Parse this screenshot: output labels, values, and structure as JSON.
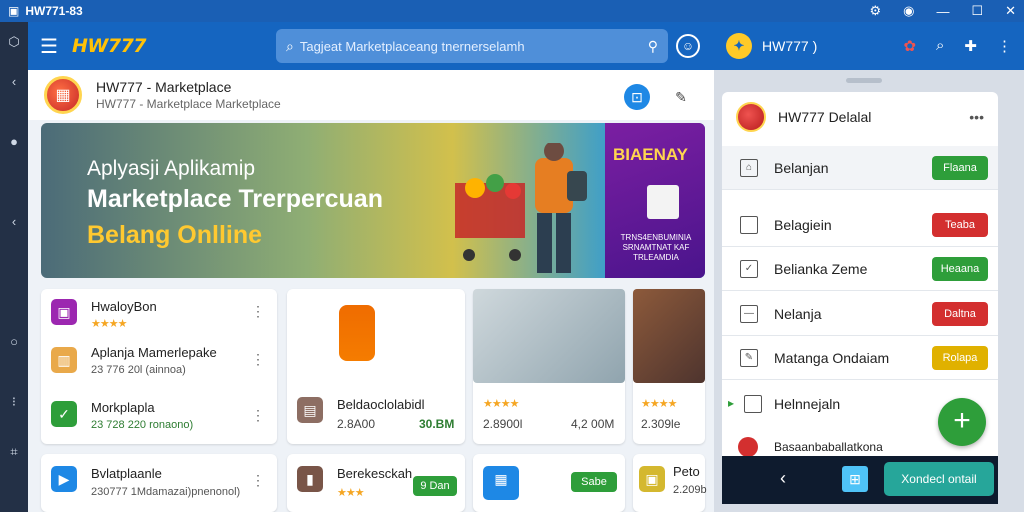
{
  "window": {
    "title": "HW771-83",
    "controls": [
      "gear-icon",
      "wifi-icon",
      "minimize-icon",
      "maximize-icon",
      "close-icon"
    ]
  },
  "app": {
    "brand": "HW777"
  },
  "search": {
    "placeholder": "Tagjeat Marketplaceang tnernerselamh"
  },
  "product_header": {
    "title": "HW777 - Marketplace",
    "subtitle": "HW777 - Marketplace Marketplace"
  },
  "banner": {
    "line1": "Aplyasji Aplikamip",
    "line2": "Marketplace Trerpercuan",
    "line3": "Belang Onlline",
    "promo_title": "BIAENAY",
    "promo_fine": "TRNS4ENBUMINIA SRNAMTNAT KAF TRLEAMDIA"
  },
  "list_card_1": {
    "items": [
      {
        "title": "HwaloyBon",
        "rating": "★★★★",
        "icon": "bag-icon"
      },
      {
        "title": "Aplanja Mamerlepake",
        "sub": "23 776 20l (ainnoa)",
        "icon": "box-icon"
      },
      {
        "title": "Morkplapla",
        "sub": "23 728 220 ronaono)",
        "icon": "check-icon"
      }
    ]
  },
  "product_cards": [
    {
      "title": "Beldaoclolabidl",
      "price": "2.8A00",
      "price2": "30.BM"
    },
    {
      "rating": "★★★★",
      "price": "2.8900l",
      "price2": "4,2 00M"
    },
    {
      "rating": "★★★★",
      "price": "2.309le"
    }
  ],
  "list_card_2": {
    "title": "Bvlatplaanle",
    "sub": "230777 1Mdamazai)pnenonol)"
  },
  "bottom_cards": [
    {
      "title": "Berekesckah",
      "rating": "★★★",
      "button": "9 Dan"
    },
    {
      "button": "Sabe"
    },
    {
      "title": "Peto",
      "price": "2.209b"
    }
  ],
  "right_header": {
    "name": "HW777 )"
  },
  "detail_panel": {
    "title": "HW777 Delalal",
    "rows": [
      {
        "label": "Belanjan",
        "button": "Flaana",
        "color": "#2e9e3a"
      },
      {
        "label": "Belagiein",
        "button": "Teaba",
        "color": "#d32f2f"
      },
      {
        "label": "Belianka Zeme",
        "button": "Heaana",
        "color": "#2e9e3a"
      },
      {
        "label": "Nelanja",
        "button": "Daltna",
        "color": "#d32f2f"
      },
      {
        "label": "Matanga Ondaiam",
        "button": "Rolapa",
        "color": "#e0b100"
      },
      {
        "label": "Helnnejaln",
        "button": "",
        "color": ""
      },
      {
        "label": "Basaanbaballatkona",
        "button": "",
        "color": ""
      }
    ],
    "cta": "Xondecl ontail"
  },
  "colors": {
    "brand_blue": "#1565c0",
    "accent_yellow": "#ffc107",
    "action_green": "#2e9e3a",
    "alert_red": "#d32f2f"
  }
}
